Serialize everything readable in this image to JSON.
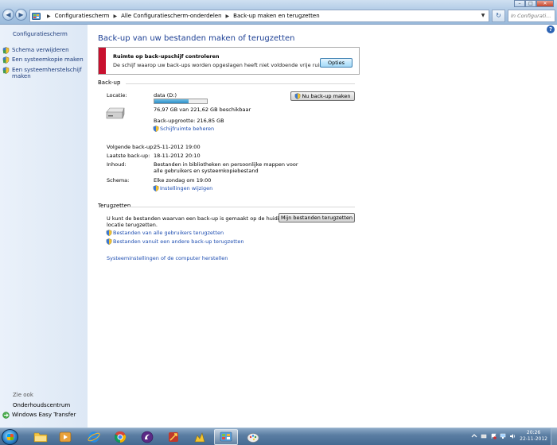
{
  "window": {
    "address": {
      "crumbs": [
        "Configuratiescherm",
        "Alle Configuratiescherm-onderdelen",
        "Back-up maken en terugzetten"
      ]
    },
    "search_placeholder": "In Configurati...",
    "controls": {
      "minimize": "–",
      "maximize": "□",
      "close": "✕"
    }
  },
  "sidebar": {
    "home": "Configuratiescherm",
    "items": [
      {
        "label": "Schema verwijderen"
      },
      {
        "label": "Een systeemkopie maken"
      },
      {
        "label": "Een systeemherstelschijf maken"
      }
    ],
    "see_also_heading": "Zie ook",
    "see_also": [
      "Onderhoudscentrum",
      "Windows Easy Transfer"
    ]
  },
  "main": {
    "help": "?",
    "title": "Back-up van uw bestanden maken of terugzetten",
    "alert": {
      "title": "Ruimte op back-upschijf controleren",
      "text": "De schijf waarop uw back-ups worden opgeslagen heeft niet voldoende vrije ruimte.",
      "button": "Opties"
    },
    "backup": {
      "heading": "Back-up",
      "location_label": "Locatie:",
      "location_value": "data (D:)",
      "space_used_fraction": 0.65,
      "space_text": "76,97 GB van 221,62 GB beschikbaar",
      "size_text": "Back-upgrootte: 216,85 GB",
      "manage_space_link": "Schijfruimte beheren",
      "backup_now_button": "Nu back-up maken",
      "next_label": "Volgende back-up:",
      "next_value": "25-11-2012 19:00",
      "last_label": "Laatste back-up:",
      "last_value": "18-11-2012 20:10",
      "contents_label": "Inhoud:",
      "contents_value_1": "Bestanden in bibliotheken en persoonlijke mappen voor",
      "contents_value_2": "alle gebruikers en systeemkopiebestand",
      "schedule_label": "Schema:",
      "schedule_value": "Elke zondag om 19:00",
      "change_settings_link": "Instellingen wijzigen"
    },
    "restore": {
      "heading": "Terugzetten",
      "text_1": "U kunt de bestanden waarvan een back-up is gemaakt op de huidige",
      "text_2": "locatie terugzetten.",
      "restore_button": "Mijn bestanden terugzetten",
      "all_users_link": "Bestanden van alle gebruikers terugzetten",
      "other_backup_link": "Bestanden vanuit een andere back-up terugzetten",
      "system_restore_link": "Systeeminstellingen of de computer herstellen"
    }
  },
  "taskbar": {
    "time": "20:26",
    "date": "22-11-2012"
  },
  "colors": {
    "link": "#1d4db1",
    "title": "#1c3f94",
    "alert_bar": "#c8102e",
    "taskbar": "#456a92"
  }
}
